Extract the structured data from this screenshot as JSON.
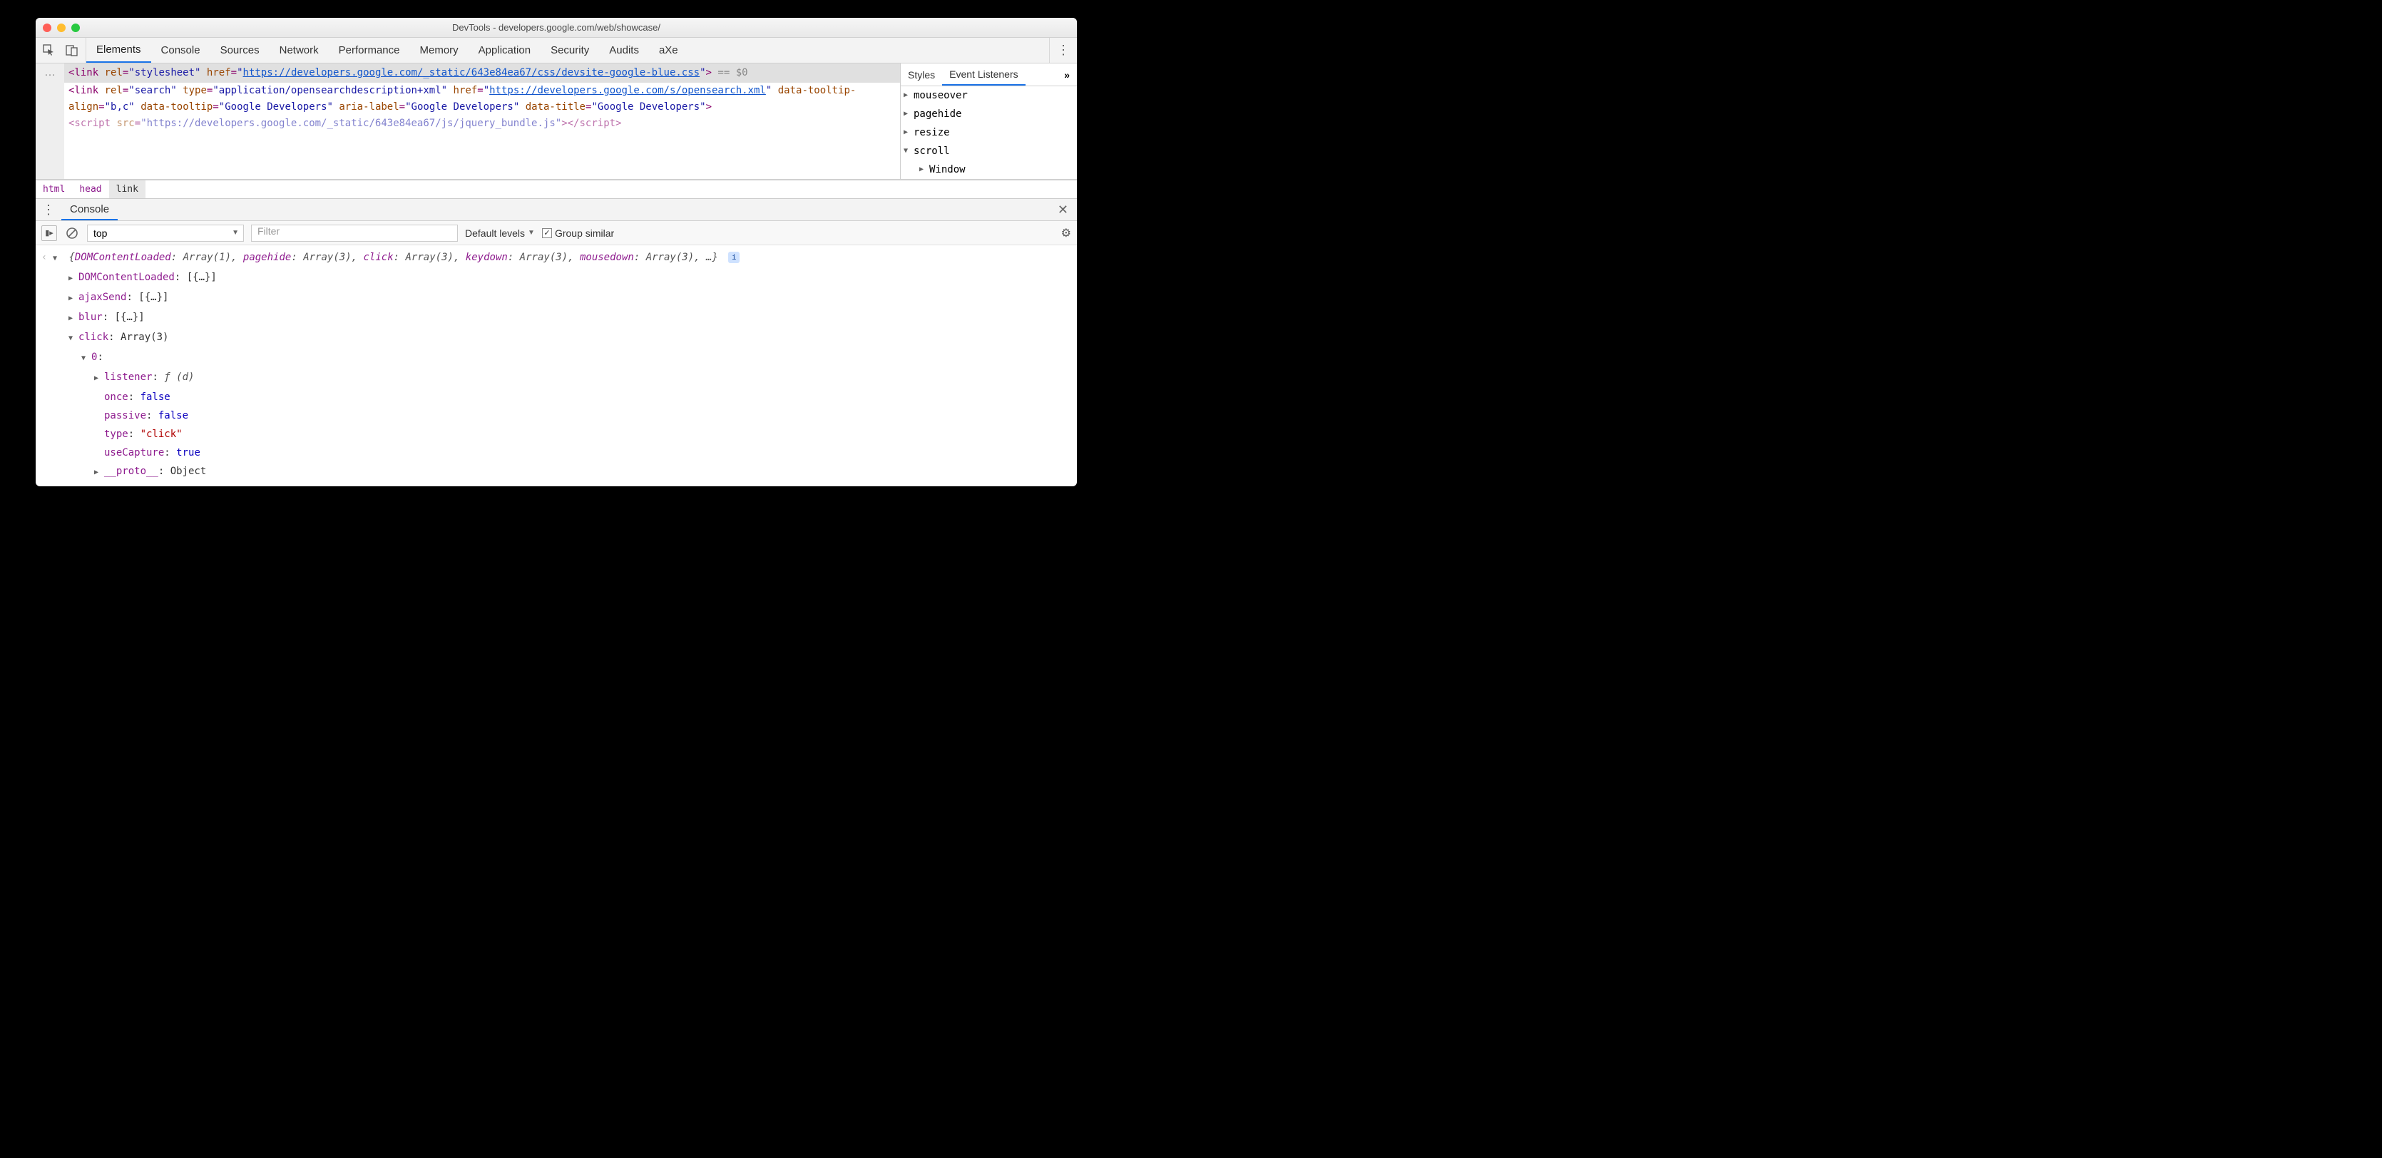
{
  "window": {
    "title": "DevTools - developers.google.com/web/showcase/"
  },
  "mainTabs": [
    "Elements",
    "Console",
    "Sources",
    "Network",
    "Performance",
    "Memory",
    "Application",
    "Security",
    "Audits",
    "aXe"
  ],
  "activeMainTab": "Elements",
  "elements": {
    "ellipsis": "…",
    "line1a": "<link rel=\"stylesheet\" href=\"",
    "line1link": "https://developers.google.com/_static/643e84ea67/css/devsite-google-blue.css",
    "line1b": "\">",
    "eq0": " == $0",
    "line2a": "<link rel=\"search\" type=\"application/opensearchdescription+xml\" href=\"",
    "line2link": "https://developers.google.com/s/opensearch.xml",
    "line2b": "\" data-tooltip-align=\"b,c\" data-tooltip=\"Google Developers\" aria-label=\"Google Developers\" data-title=\"Google Developers\">",
    "line3": "<script src=\"https://developers.google.com/_static/643e84ea67/js/jquery_bundle.js\"></scr ipt>"
  },
  "breadcrumb": [
    "html",
    "head",
    "link"
  ],
  "sidebar": {
    "tabs": [
      "Styles",
      "Event Listeners"
    ],
    "active": "Event Listeners",
    "listeners": [
      {
        "name": "mouseover",
        "open": false,
        "indent": 0,
        "disc": "▶"
      },
      {
        "name": "pagehide",
        "open": false,
        "indent": 0,
        "disc": "▶"
      },
      {
        "name": "resize",
        "open": false,
        "indent": 0,
        "disc": "▶"
      },
      {
        "name": "scroll",
        "open": true,
        "indent": 0,
        "disc": "▼"
      },
      {
        "name": "Window",
        "open": false,
        "indent": 1,
        "disc": "▶"
      }
    ]
  },
  "drawer": {
    "tab": "Console"
  },
  "consoleToolbar": {
    "context": "top",
    "filterPlaceholder": "Filter",
    "levels": "Default levels",
    "groupSimilar": "Group similar"
  },
  "consoleOutput": {
    "summaryPairs": [
      {
        "k": "DOMContentLoaded",
        "v": "Array(1)"
      },
      {
        "k": "pagehide",
        "v": "Array(3)"
      },
      {
        "k": "click",
        "v": "Array(3)"
      },
      {
        "k": "keydown",
        "v": "Array(3)"
      },
      {
        "k": "mousedown",
        "v": "Array(3)"
      }
    ],
    "summaryTail": ", …}",
    "lines": [
      {
        "indent": 1,
        "disc": "▶",
        "key": "DOMContentLoaded",
        "colon": ": ",
        "val": "[{…}]"
      },
      {
        "indent": 1,
        "disc": "▶",
        "key": "ajaxSend",
        "colon": ": ",
        "val": "[{…}]"
      },
      {
        "indent": 1,
        "disc": "▶",
        "key": "blur",
        "colon": ": ",
        "val": "[{…}]"
      },
      {
        "indent": 1,
        "disc": "▼",
        "key": "click",
        "colon": ": ",
        "val": "Array(3)"
      },
      {
        "indent": 2,
        "disc": "▼",
        "key": "0",
        "colon": ":",
        "val": ""
      },
      {
        "indent": 3,
        "disc": "▶",
        "key": "listener",
        "colon": ": ",
        "valItalic": "ƒ (d)"
      },
      {
        "indent": 3,
        "disc": "",
        "key": "once",
        "colon": ": ",
        "bool": "false"
      },
      {
        "indent": 3,
        "disc": "",
        "key": "passive",
        "colon": ": ",
        "bool": "false"
      },
      {
        "indent": 3,
        "disc": "",
        "key": "type",
        "colon": ": ",
        "str": "\"click\""
      },
      {
        "indent": 3,
        "disc": "",
        "key": "useCapture",
        "colon": ": ",
        "bool": "true"
      },
      {
        "indent": 3,
        "disc": "▶",
        "key": "__proto__",
        "colon": ": ",
        "val": "Object"
      }
    ]
  }
}
